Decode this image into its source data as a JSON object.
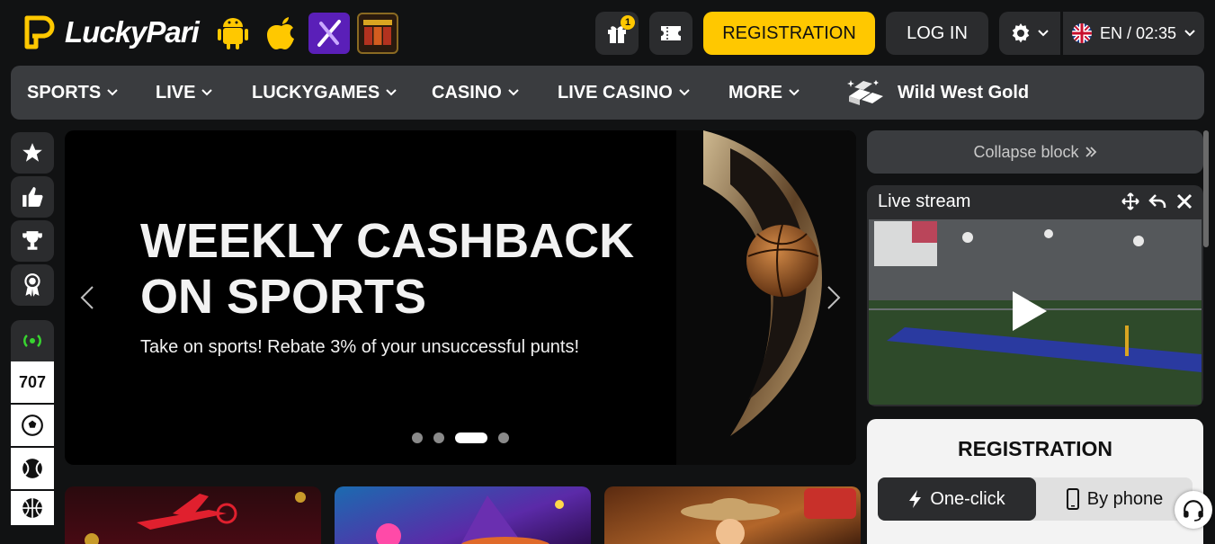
{
  "header": {
    "logo_text": "LuckyPari",
    "apps": [
      {
        "name": "android-icon"
      },
      {
        "name": "apple-icon"
      },
      {
        "name": "x-app-icon"
      },
      {
        "name": "slot-machine-icon"
      }
    ],
    "gift_badge": "1",
    "registration_label": "REGISTRATION",
    "login_label": "LOG IN",
    "language_time": "EN / 02:35"
  },
  "nav": {
    "items": [
      "SPORTS",
      "LIVE",
      "LUCKYGAMES",
      "CASINO",
      "LIVE CASINO",
      "MORE"
    ],
    "promo_label": "Wild West Gold"
  },
  "sidebar": {
    "live_count": "707"
  },
  "banner": {
    "title": "WEEKLY CASHBACK ON SPORTS",
    "subtitle": "Take on sports! Rebate 3% of your unsuccessful punts!",
    "active_slide": 3,
    "slide_count": 4
  },
  "right": {
    "collapse_label": "Collapse block",
    "stream_title": "Live stream",
    "registration_title": "REGISTRATION",
    "tab_oneclick": "One-click",
    "tab_phone": "By phone"
  },
  "colors": {
    "accent": "#ffc800",
    "background": "#111213",
    "panel": "#3a3c3f"
  }
}
